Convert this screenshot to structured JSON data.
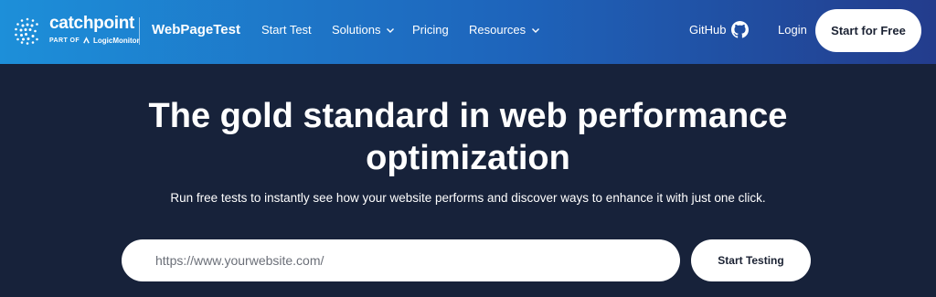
{
  "brand": {
    "name": "catchpoint",
    "part_of": "PART OF",
    "parent": "LogicMonitor",
    "product": "WebPageTest"
  },
  "nav": {
    "start_test": "Start Test",
    "solutions": "Solutions",
    "pricing": "Pricing",
    "resources": "Resources",
    "github": "GitHub",
    "login": "Login",
    "cta": "Start for Free"
  },
  "hero": {
    "title_line1": "The gold standard in web performance",
    "title_line2": "optimization",
    "subtitle": "Run free tests to instantly see how your website performs and discover ways to enhance it with just one click.",
    "url_placeholder": "https://www.yourwebsite.com/",
    "url_value": "",
    "submit_label": "Start Testing"
  },
  "colors": {
    "nav_gradient_start": "#1d8fd9",
    "nav_gradient_end": "#233c8c",
    "hero_background": "#17223a",
    "button_background": "#ffffff"
  },
  "icons": {
    "brand": "catchpoint-globe-icon",
    "parent": "logicmonitor-icon",
    "dropdown": "chevron-down-icon",
    "github": "github-icon"
  }
}
